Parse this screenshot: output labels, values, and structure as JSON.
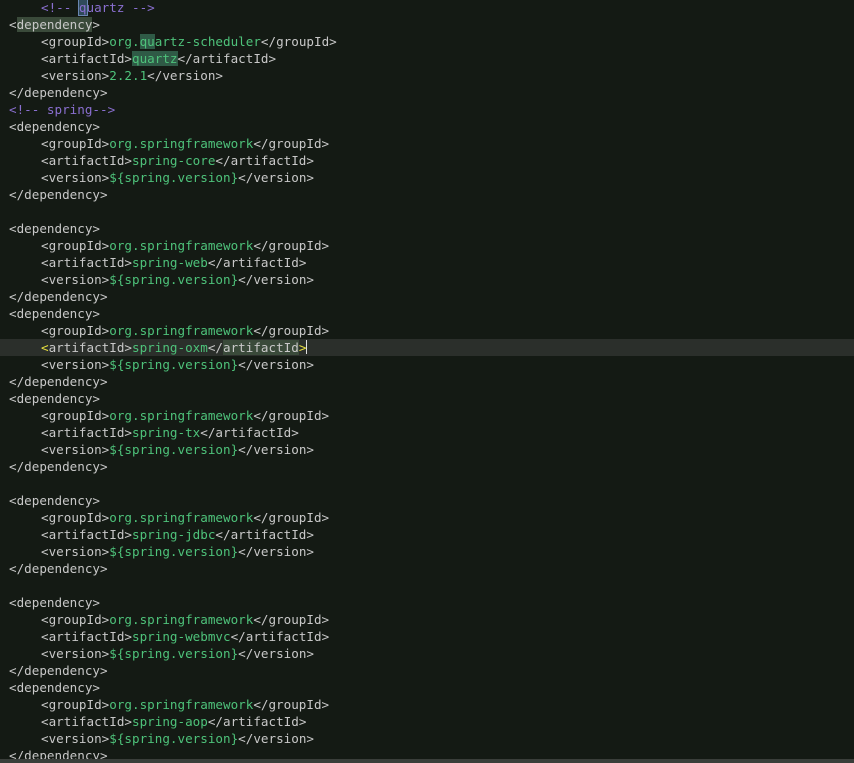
{
  "lines": [
    {
      "indent": 1,
      "parts": [
        {
          "t": "<!-- ",
          "c": "comment"
        },
        {
          "t": "q",
          "c": "comment hl-box"
        },
        {
          "t": "uartz -->",
          "c": "comment"
        }
      ]
    },
    {
      "indent": 0,
      "parts": [
        {
          "t": "<",
          "c": "tag"
        },
        {
          "t": "dependency",
          "c": "tag hl-tag"
        },
        {
          "t": ">",
          "c": "tag"
        }
      ]
    },
    {
      "indent": 1,
      "parts": [
        {
          "t": "<groupId>",
          "c": "tag"
        },
        {
          "t": "org.",
          "c": "val"
        },
        {
          "t": "qu",
          "c": "val hl-word"
        },
        {
          "t": "artz-scheduler",
          "c": "val"
        },
        {
          "t": "</groupId>",
          "c": "tag"
        }
      ]
    },
    {
      "indent": 1,
      "parts": [
        {
          "t": "<artifactId>",
          "c": "tag"
        },
        {
          "t": "quartz",
          "c": "val hl-word"
        },
        {
          "t": "</artifactId>",
          "c": "tag"
        }
      ]
    },
    {
      "indent": 1,
      "parts": [
        {
          "t": "<version>",
          "c": "tag"
        },
        {
          "t": "2.2.1",
          "c": "val"
        },
        {
          "t": "</version>",
          "c": "tag"
        }
      ]
    },
    {
      "indent": 0,
      "parts": [
        {
          "t": "</dependency>",
          "c": "tag"
        }
      ]
    },
    {
      "indent": 0,
      "parts": [
        {
          "t": "<!-- spring-->",
          "c": "comment"
        }
      ]
    },
    {
      "indent": 0,
      "parts": [
        {
          "t": "<dependency>",
          "c": "tag"
        }
      ]
    },
    {
      "indent": 1,
      "parts": [
        {
          "t": "<groupId>",
          "c": "tag"
        },
        {
          "t": "org.springframework",
          "c": "val"
        },
        {
          "t": "</groupId>",
          "c": "tag"
        }
      ]
    },
    {
      "indent": 1,
      "parts": [
        {
          "t": "<artifactId>",
          "c": "tag"
        },
        {
          "t": "spring-core",
          "c": "val"
        },
        {
          "t": "</artifactId>",
          "c": "tag"
        }
      ]
    },
    {
      "indent": 1,
      "parts": [
        {
          "t": "<version>",
          "c": "tag"
        },
        {
          "t": "${spring.version}",
          "c": "var"
        },
        {
          "t": "</version>",
          "c": "tag"
        }
      ]
    },
    {
      "indent": 0,
      "parts": [
        {
          "t": "</dependency>",
          "c": "tag"
        }
      ]
    },
    {
      "indent": 0,
      "parts": []
    },
    {
      "indent": 0,
      "parts": [
        {
          "t": "<dependency>",
          "c": "tag"
        }
      ]
    },
    {
      "indent": 1,
      "parts": [
        {
          "t": "<groupId>",
          "c": "tag"
        },
        {
          "t": "org.springframework",
          "c": "val"
        },
        {
          "t": "</groupId>",
          "c": "tag"
        }
      ]
    },
    {
      "indent": 1,
      "parts": [
        {
          "t": "<artifactId>",
          "c": "tag"
        },
        {
          "t": "spring-web",
          "c": "val"
        },
        {
          "t": "</artifactId>",
          "c": "tag"
        }
      ]
    },
    {
      "indent": 1,
      "parts": [
        {
          "t": "<version>",
          "c": "tag"
        },
        {
          "t": "${spring.version}",
          "c": "var"
        },
        {
          "t": "</version>",
          "c": "tag"
        }
      ]
    },
    {
      "indent": 0,
      "parts": [
        {
          "t": "</dependency>",
          "c": "tag"
        }
      ]
    },
    {
      "indent": 0,
      "parts": [
        {
          "t": "<dependency>",
          "c": "tag"
        }
      ]
    },
    {
      "indent": 1,
      "parts": [
        {
          "t": "<groupId>",
          "c": "tag"
        },
        {
          "t": "org.springframework",
          "c": "val"
        },
        {
          "t": "</groupId>",
          "c": "tag"
        }
      ]
    },
    {
      "indent": 1,
      "current": true,
      "parts": [
        {
          "t": "<",
          "c": "bracket"
        },
        {
          "t": "artifactId>",
          "c": "tag"
        },
        {
          "t": "spring-oxm",
          "c": "val"
        },
        {
          "t": "</",
          "c": "tag"
        },
        {
          "t": "artifactId",
          "c": "tag hl-tag"
        },
        {
          "t": ">",
          "c": "bracket"
        },
        {
          "t": "",
          "c": "caret"
        }
      ]
    },
    {
      "indent": 1,
      "parts": [
        {
          "t": "<version>",
          "c": "tag"
        },
        {
          "t": "${spring.version}",
          "c": "var"
        },
        {
          "t": "</version>",
          "c": "tag"
        }
      ]
    },
    {
      "indent": 0,
      "parts": [
        {
          "t": "</dependency>",
          "c": "tag"
        }
      ]
    },
    {
      "indent": 0,
      "parts": [
        {
          "t": "<dependency>",
          "c": "tag"
        }
      ]
    },
    {
      "indent": 1,
      "parts": [
        {
          "t": "<groupId>",
          "c": "tag"
        },
        {
          "t": "org.springframework",
          "c": "val"
        },
        {
          "t": "</groupId>",
          "c": "tag"
        }
      ]
    },
    {
      "indent": 1,
      "parts": [
        {
          "t": "<artifactId>",
          "c": "tag"
        },
        {
          "t": "spring-tx",
          "c": "val"
        },
        {
          "t": "</artifactId>",
          "c": "tag"
        }
      ]
    },
    {
      "indent": 1,
      "parts": [
        {
          "t": "<version>",
          "c": "tag"
        },
        {
          "t": "${spring.version}",
          "c": "var"
        },
        {
          "t": "</version>",
          "c": "tag"
        }
      ]
    },
    {
      "indent": 0,
      "parts": [
        {
          "t": "</dependency>",
          "c": "tag"
        }
      ]
    },
    {
      "indent": 0,
      "parts": []
    },
    {
      "indent": 0,
      "parts": [
        {
          "t": "<dependency>",
          "c": "tag"
        }
      ]
    },
    {
      "indent": 1,
      "parts": [
        {
          "t": "<groupId>",
          "c": "tag"
        },
        {
          "t": "org.springframework",
          "c": "val"
        },
        {
          "t": "</groupId>",
          "c": "tag"
        }
      ]
    },
    {
      "indent": 1,
      "parts": [
        {
          "t": "<artifactId>",
          "c": "tag"
        },
        {
          "t": "spring-jdbc",
          "c": "val"
        },
        {
          "t": "</artifactId>",
          "c": "tag"
        }
      ]
    },
    {
      "indent": 1,
      "parts": [
        {
          "t": "<version>",
          "c": "tag"
        },
        {
          "t": "${spring.version}",
          "c": "var"
        },
        {
          "t": "</version>",
          "c": "tag"
        }
      ]
    },
    {
      "indent": 0,
      "parts": [
        {
          "t": "</dependency>",
          "c": "tag"
        }
      ]
    },
    {
      "indent": 0,
      "parts": []
    },
    {
      "indent": 0,
      "parts": [
        {
          "t": "<dependency>",
          "c": "tag"
        }
      ]
    },
    {
      "indent": 1,
      "parts": [
        {
          "t": "<groupId>",
          "c": "tag"
        },
        {
          "t": "org.springframework",
          "c": "val"
        },
        {
          "t": "</groupId>",
          "c": "tag"
        }
      ]
    },
    {
      "indent": 1,
      "parts": [
        {
          "t": "<artifactId>",
          "c": "tag"
        },
        {
          "t": "spring-webmvc",
          "c": "val"
        },
        {
          "t": "</artifactId>",
          "c": "tag"
        }
      ]
    },
    {
      "indent": 1,
      "parts": [
        {
          "t": "<version>",
          "c": "tag"
        },
        {
          "t": "${spring.version}",
          "c": "var"
        },
        {
          "t": "</version>",
          "c": "tag"
        }
      ]
    },
    {
      "indent": 0,
      "parts": [
        {
          "t": "</dependency>",
          "c": "tag"
        }
      ]
    },
    {
      "indent": 0,
      "parts": [
        {
          "t": "<dependency>",
          "c": "tag"
        }
      ]
    },
    {
      "indent": 1,
      "parts": [
        {
          "t": "<groupId>",
          "c": "tag"
        },
        {
          "t": "org.springframework",
          "c": "val"
        },
        {
          "t": "</groupId>",
          "c": "tag"
        }
      ]
    },
    {
      "indent": 1,
      "parts": [
        {
          "t": "<artifactId>",
          "c": "tag"
        },
        {
          "t": "spring-aop",
          "c": "val"
        },
        {
          "t": "</artifactId>",
          "c": "tag"
        }
      ]
    },
    {
      "indent": 1,
      "parts": [
        {
          "t": "<version>",
          "c": "tag"
        },
        {
          "t": "${spring.version}",
          "c": "var"
        },
        {
          "t": "</version>",
          "c": "tag"
        }
      ]
    },
    {
      "indent": 0,
      "parts": [
        {
          "t": "</dependency>",
          "c": "tag"
        }
      ]
    }
  ]
}
